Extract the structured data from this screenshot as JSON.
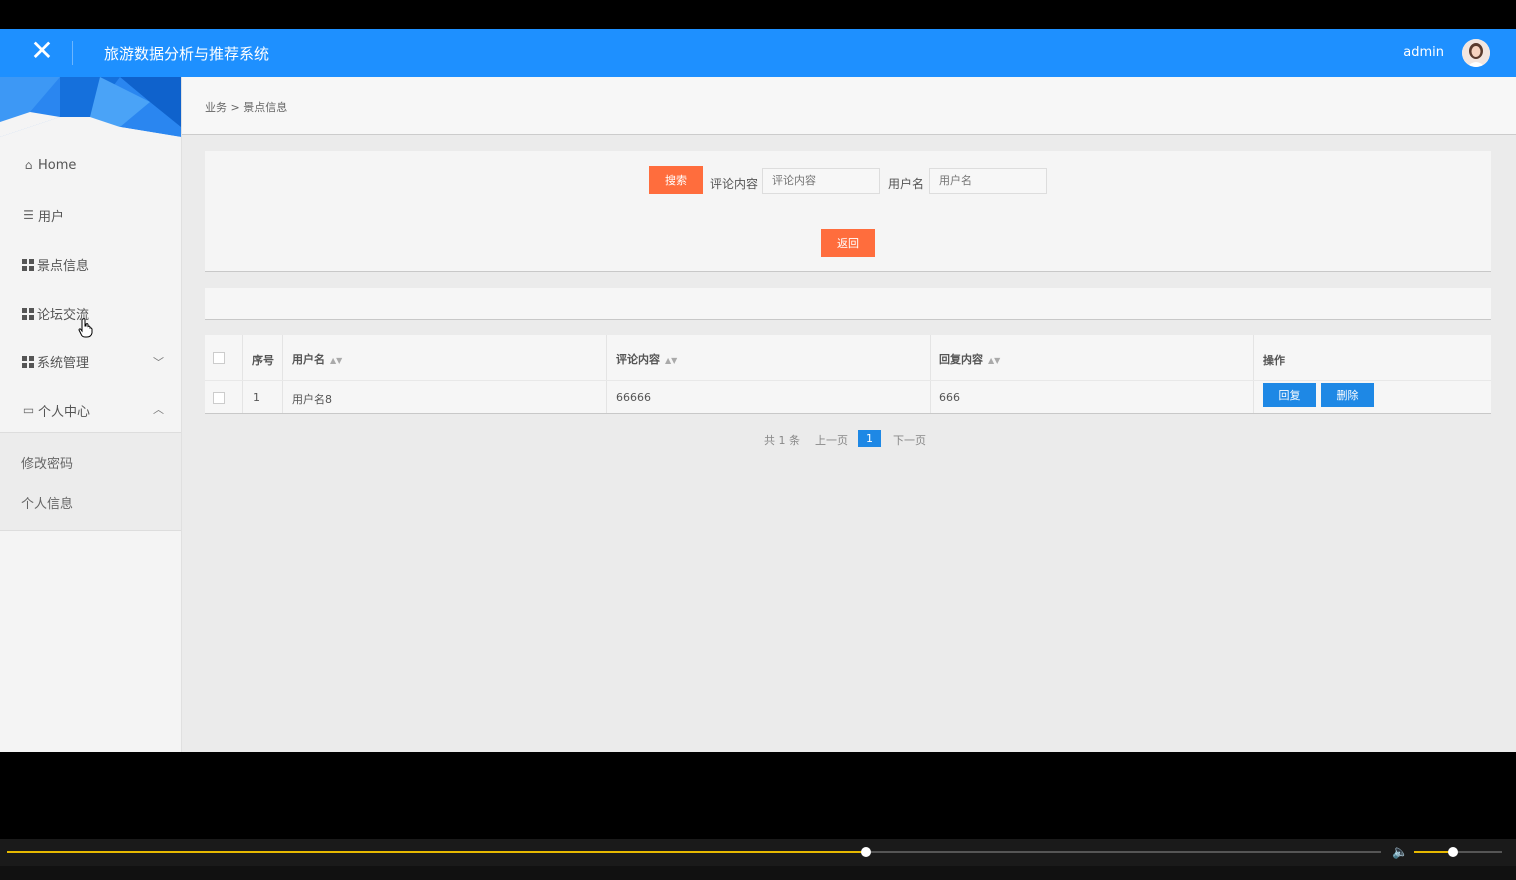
{
  "header": {
    "title": "旅游数据分析与推荐系统",
    "user": "admin",
    "brand_color": "#1e90ff"
  },
  "sidebar": {
    "items": [
      {
        "label": "Home",
        "icon": "home-icon"
      },
      {
        "label": "用户",
        "icon": "sliders-icon"
      },
      {
        "label": "景点信息",
        "icon": "grid-icon"
      },
      {
        "label": "论坛交流",
        "icon": "grid-icon"
      },
      {
        "label": "系统管理",
        "icon": "grid-icon"
      },
      {
        "label": "个人中心",
        "icon": "calendar-icon"
      }
    ],
    "sub_items": [
      {
        "label": "修改密码"
      },
      {
        "label": "个人信息"
      }
    ]
  },
  "breadcrumb": {
    "root": "业务",
    "separator": ">",
    "current": "景点信息"
  },
  "search": {
    "search_button": "搜索",
    "comment_label": "评论内容",
    "comment_placeholder": "评论内容",
    "user_label": "用户名",
    "user_placeholder": "用户名",
    "back_button": "返回"
  },
  "table": {
    "headers": [
      "序号",
      "用户名",
      "评论内容",
      "回复内容",
      "操作"
    ],
    "rows": [
      {
        "index": "1",
        "user": "用户名8",
        "comment": "66666",
        "reply": "666",
        "reply_btn": "回复",
        "delete_btn": "删除"
      }
    ]
  },
  "pagination": {
    "total": "共 1 条",
    "prev": "上一页",
    "current": "1",
    "next": "下一页"
  },
  "player": {
    "progress": 0.625,
    "volume": 0.44,
    "accent": "#e6b800"
  }
}
